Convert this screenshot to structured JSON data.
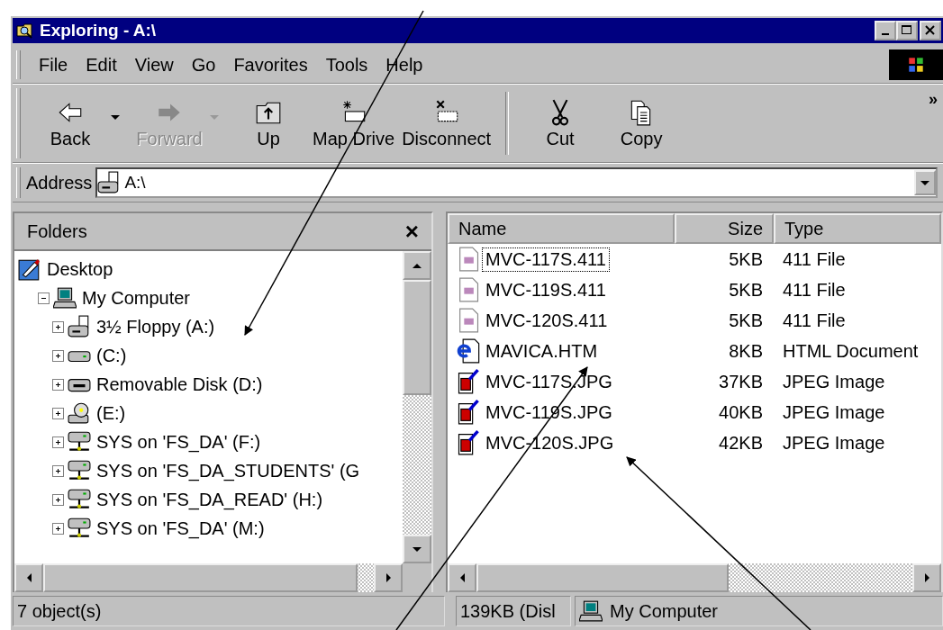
{
  "window": {
    "title": "Exploring - A:\\"
  },
  "menu": [
    "File",
    "Edit",
    "View",
    "Go",
    "Favorites",
    "Tools",
    "Help"
  ],
  "toolbar": [
    {
      "label": "Back",
      "kind": "back",
      "disabled": false,
      "dropdown": true
    },
    {
      "label": "Forward",
      "kind": "forward",
      "disabled": true,
      "dropdown": true
    },
    {
      "label": "Up",
      "kind": "up",
      "disabled": false,
      "dropdown": false
    },
    {
      "label": "Map Drive",
      "kind": "map",
      "disabled": false,
      "dropdown": false
    },
    {
      "label": "Disconnect",
      "kind": "disconnect",
      "disabled": false,
      "dropdown": false
    },
    {
      "label": "Cut",
      "kind": "cut",
      "disabled": false,
      "dropdown": false
    },
    {
      "label": "Copy",
      "kind": "copy",
      "disabled": false,
      "dropdown": false
    }
  ],
  "toolbar_more": "»",
  "address": {
    "label": "Address",
    "value": "A:\\"
  },
  "folders": {
    "title": "Folders",
    "close": "×",
    "tree": [
      {
        "label": "Desktop",
        "kind": "desktop",
        "children": [
          {
            "label": "My Computer",
            "kind": "computer",
            "expanded": true,
            "children": [
              {
                "label": "3½ Floppy (A:)",
                "kind": "floppy",
                "expanded": false
              },
              {
                "label": "(C:)",
                "kind": "harddisk",
                "expanded": false
              },
              {
                "label": "Removable Disk (D:)",
                "kind": "removable",
                "expanded": false
              },
              {
                "label": "(E:)",
                "kind": "cdrom",
                "expanded": false
              },
              {
                "label": "SYS on 'FS_DA' (F:)",
                "kind": "network",
                "expanded": false
              },
              {
                "label": "SYS on 'FS_DA_STUDENTS' (G",
                "kind": "network",
                "expanded": false
              },
              {
                "label": "SYS on 'FS_DA_READ' (H:)",
                "kind": "network",
                "expanded": false
              },
              {
                "label": "SYS on 'FS_DA' (M:)",
                "kind": "network",
                "expanded": false
              }
            ]
          }
        ]
      }
    ]
  },
  "files": {
    "columns": [
      "Name",
      "Size",
      "Type"
    ],
    "rows": [
      {
        "name": "MVC-117S.411",
        "size": "5KB",
        "type": "411 File",
        "kind": "generic",
        "focused": true
      },
      {
        "name": "MVC-119S.411",
        "size": "5KB",
        "type": "411 File",
        "kind": "generic",
        "focused": false
      },
      {
        "name": "MVC-120S.411",
        "size": "5KB",
        "type": "411 File",
        "kind": "generic",
        "focused": false
      },
      {
        "name": "MAVICA.HTM",
        "size": "8KB",
        "type": "HTML Document",
        "kind": "html",
        "focused": false
      },
      {
        "name": "MVC-117S.JPG",
        "size": "37KB",
        "type": "JPEG Image",
        "kind": "jpeg",
        "focused": false
      },
      {
        "name": "MVC-119S.JPG",
        "size": "40KB",
        "type": "JPEG Image",
        "kind": "jpeg",
        "focused": false
      },
      {
        "name": "MVC-120S.JPG",
        "size": "42KB",
        "type": "JPEG Image",
        "kind": "jpeg",
        "focused": false
      }
    ]
  },
  "status_bar": {
    "objects": "7 object(s)",
    "size": "139KB (Disl",
    "zone": "My Computer"
  }
}
